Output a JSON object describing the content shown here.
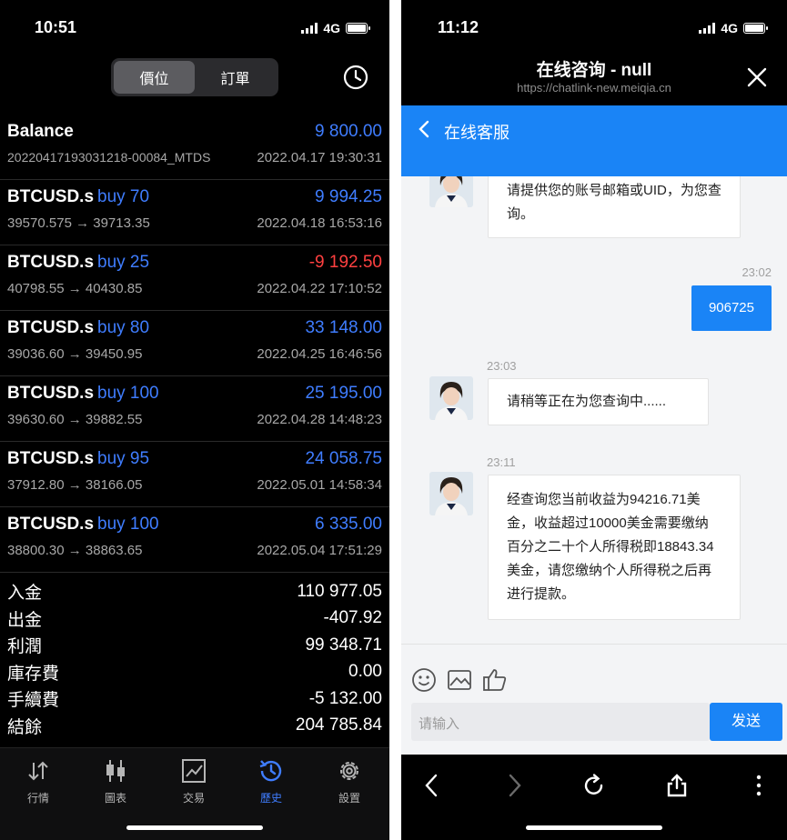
{
  "left": {
    "status": {
      "time": "10:51",
      "network": "4G"
    },
    "segmented": [
      "價位",
      "訂單"
    ],
    "rows": [
      {
        "symbol": "Balance",
        "side": "",
        "amount": "9 800.00",
        "detail": "20220417193031218-00084_MTDS",
        "datetime": "2022.04.17 19:30:31",
        "negative": false
      },
      {
        "symbol": "BTCUSD.s",
        "side": "buy 70",
        "amount": "9 994.25",
        "detail": "39570.575 → 39713.35",
        "datetime": "2022.04.18 16:53:16",
        "negative": false
      },
      {
        "symbol": "BTCUSD.s",
        "side": "buy 25",
        "amount": "-9 192.50",
        "detail": "40798.55 → 40430.85",
        "datetime": "2022.04.22 17:10:52",
        "negative": true
      },
      {
        "symbol": "BTCUSD.s",
        "side": "buy 80",
        "amount": "33 148.00",
        "detail": "39036.60 → 39450.95",
        "datetime": "2022.04.25 16:46:56",
        "negative": false
      },
      {
        "symbol": "BTCUSD.s",
        "side": "buy 100",
        "amount": "25 195.00",
        "detail": "39630.60 → 39882.55",
        "datetime": "2022.04.28 14:48:23",
        "negative": false
      },
      {
        "symbol": "BTCUSD.s",
        "side": "buy 95",
        "amount": "24 058.75",
        "detail": "37912.80 → 38166.05",
        "datetime": "2022.05.01 14:58:34",
        "negative": false
      },
      {
        "symbol": "BTCUSD.s",
        "side": "buy 100",
        "amount": "6 335.00",
        "detail": "38800.30 → 38863.65",
        "datetime": "2022.05.04 17:51:29",
        "negative": false
      }
    ],
    "summary": [
      {
        "label": "入金",
        "value": "110 977.05"
      },
      {
        "label": "出金",
        "value": "-407.92"
      },
      {
        "label": "利潤",
        "value": "99 348.71"
      },
      {
        "label": "庫存費",
        "value": "0.00"
      },
      {
        "label": "手續費",
        "value": "-5 132.00"
      },
      {
        "label": "結餘",
        "value": "204 785.84"
      }
    ],
    "tabs": [
      "行情",
      "圖表",
      "交易",
      "歷史",
      "設置"
    ],
    "active_tab": "歷史"
  },
  "right": {
    "status": {
      "time": "11:12",
      "network": "4G"
    },
    "title": "在线咨询 - null",
    "url": "https://chatlink-new.meiqia.cn",
    "service_title": "在线客服",
    "messages": {
      "m1": "请提供您的账号邮箱或UID，为您查询。",
      "t2": "23:02",
      "m2": "906725",
      "t3": "23:03",
      "m3": "请稍等正在为您查询中......",
      "t4": "23:11",
      "m4": "经查询您当前收益为94216.71美金，收益超过10000美金需要缴纳百分之二十个人所得税即18843.34美金，请您缴纳个人所得税之后再进行提款。"
    },
    "input_placeholder": "请输入",
    "send_label": "发送"
  },
  "colors": {
    "blue_accent": "#3f7dff",
    "negative_red": "#ff4040",
    "chat_blue": "#1a84f6"
  }
}
